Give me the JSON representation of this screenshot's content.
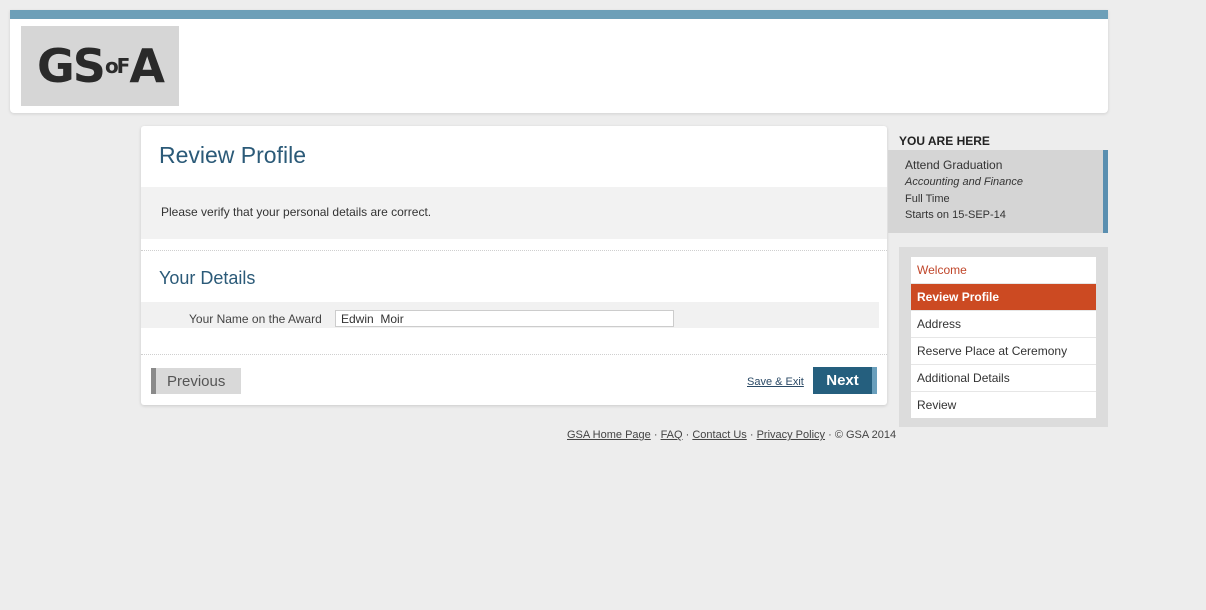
{
  "header": {
    "logo_main": "GS",
    "logo_of": "oF",
    "logo_end": "A",
    "accent_color": "#6d9fb8"
  },
  "main": {
    "title": "Review Profile",
    "intro": "Please verify that your personal details are correct.",
    "section_title": "Your Details",
    "field_label": "Your Name on the Award",
    "field_value": "Edwin  Moir",
    "previous_label": "Previous",
    "save_exit_label": "Save & Exit",
    "next_label": "Next"
  },
  "footer": {
    "links": [
      "GSA Home Page",
      "FAQ",
      "Contact Us",
      "Privacy Policy"
    ],
    "copyright": "© GSA 2014"
  },
  "sidebar": {
    "you_are_here": "YOU ARE HERE",
    "context": {
      "line1": "Attend Graduation",
      "line2": "Accounting and Finance",
      "line3": "Full Time",
      "line4": "Starts on 15-SEP-14"
    },
    "steps": [
      {
        "label": "Welcome",
        "state": "done"
      },
      {
        "label": "Review Profile",
        "state": "active"
      },
      {
        "label": "Address",
        "state": "pending"
      },
      {
        "label": "Reserve Place at Ceremony",
        "state": "pending"
      },
      {
        "label": "Additional Details",
        "state": "pending"
      },
      {
        "label": "Review",
        "state": "pending"
      }
    ]
  }
}
